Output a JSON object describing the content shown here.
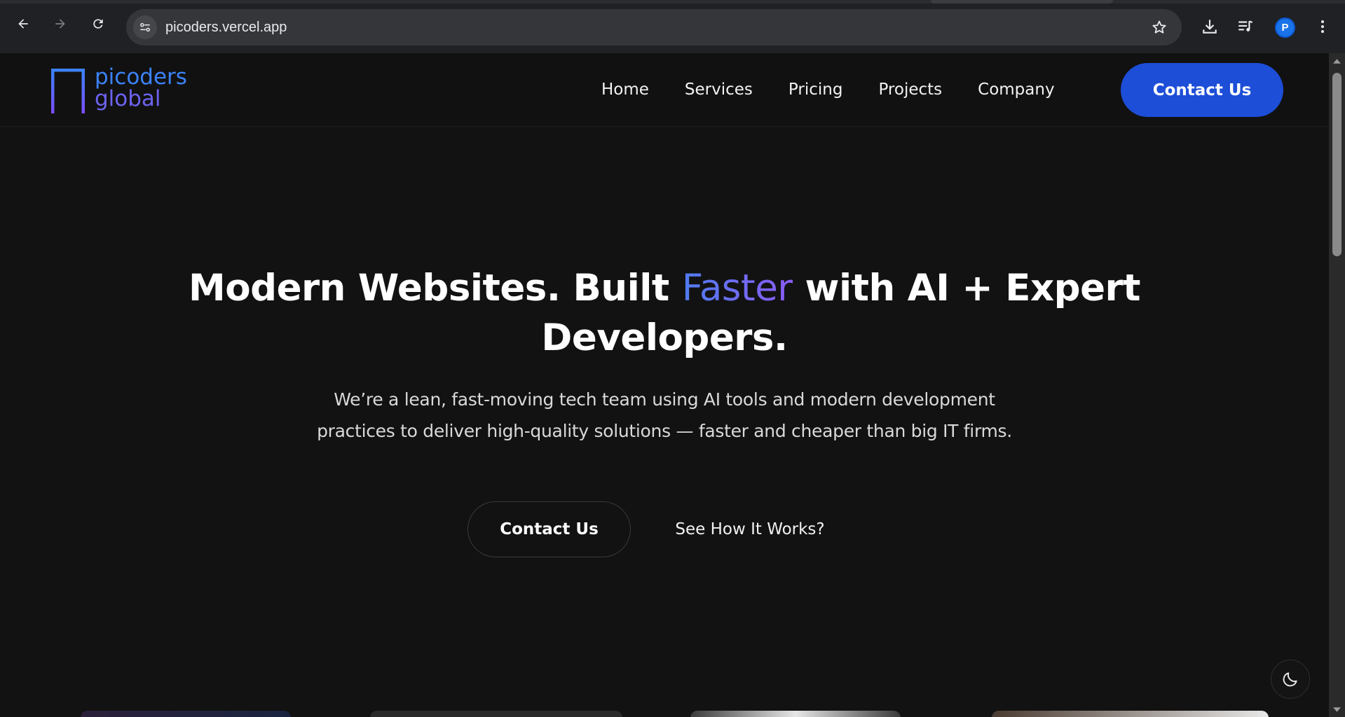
{
  "browser": {
    "url": "picoders.vercel.app",
    "profile_initial": "P",
    "icons": {
      "back": "arrow-left-icon",
      "forward": "arrow-right-icon",
      "reload": "reload-icon",
      "site_info": "tune-icon",
      "bookmark": "star-icon",
      "downloads": "download-icon",
      "media": "media-queue-icon",
      "menu": "kebab-menu-icon"
    }
  },
  "header": {
    "logo": {
      "line1": "picoders",
      "line2": "global"
    },
    "nav": [
      "Home",
      "Services",
      "Pricing",
      "Projects",
      "Company"
    ],
    "cta_label": "Contact Us"
  },
  "hero": {
    "title_part1": "Modern Websites. Built ",
    "title_accent": "Faster",
    "title_part2": " with AI + Expert Developers.",
    "subtitle": "We’re a lean, fast-moving tech team using AI tools and modern development practices to deliver high-quality solutions — faster and cheaper than big IT firms.",
    "primary_button": "Contact Us",
    "secondary_button": "See How It Works?"
  },
  "theme_toggle": {
    "icon": "moon-icon"
  },
  "colors": {
    "background": "#121212",
    "brand_blue": "#1d4ed8",
    "logo_blue": "#3b82f6",
    "logo_purple": "#6c63f0",
    "accent_gradient_start": "#4f7cf0",
    "accent_gradient_end": "#8b5cf6"
  }
}
